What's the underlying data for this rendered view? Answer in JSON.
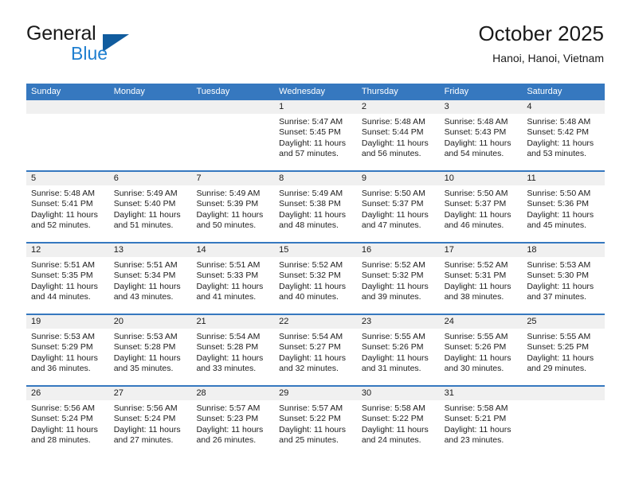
{
  "brand": {
    "name_part1": "General",
    "name_part2": "Blue",
    "accent_color": "#1f7fd0",
    "triangle_color": "#115c9e"
  },
  "header": {
    "title": "October 2025",
    "subtitle": "Hanoi, Hanoi, Vietnam",
    "header_bar_color": "#3678bf"
  },
  "weekdays": [
    "Sunday",
    "Monday",
    "Tuesday",
    "Wednesday",
    "Thursday",
    "Friday",
    "Saturday"
  ],
  "weeks": [
    [
      {
        "day": "",
        "empty": true
      },
      {
        "day": "",
        "empty": true
      },
      {
        "day": "",
        "empty": true
      },
      {
        "day": "1",
        "sunrise": "Sunrise: 5:47 AM",
        "sunset": "Sunset: 5:45 PM",
        "daylight": "Daylight: 11 hours and 57 minutes."
      },
      {
        "day": "2",
        "sunrise": "Sunrise: 5:48 AM",
        "sunset": "Sunset: 5:44 PM",
        "daylight": "Daylight: 11 hours and 56 minutes."
      },
      {
        "day": "3",
        "sunrise": "Sunrise: 5:48 AM",
        "sunset": "Sunset: 5:43 PM",
        "daylight": "Daylight: 11 hours and 54 minutes."
      },
      {
        "day": "4",
        "sunrise": "Sunrise: 5:48 AM",
        "sunset": "Sunset: 5:42 PM",
        "daylight": "Daylight: 11 hours and 53 minutes."
      }
    ],
    [
      {
        "day": "5",
        "sunrise": "Sunrise: 5:48 AM",
        "sunset": "Sunset: 5:41 PM",
        "daylight": "Daylight: 11 hours and 52 minutes."
      },
      {
        "day": "6",
        "sunrise": "Sunrise: 5:49 AM",
        "sunset": "Sunset: 5:40 PM",
        "daylight": "Daylight: 11 hours and 51 minutes."
      },
      {
        "day": "7",
        "sunrise": "Sunrise: 5:49 AM",
        "sunset": "Sunset: 5:39 PM",
        "daylight": "Daylight: 11 hours and 50 minutes."
      },
      {
        "day": "8",
        "sunrise": "Sunrise: 5:49 AM",
        "sunset": "Sunset: 5:38 PM",
        "daylight": "Daylight: 11 hours and 48 minutes."
      },
      {
        "day": "9",
        "sunrise": "Sunrise: 5:50 AM",
        "sunset": "Sunset: 5:37 PM",
        "daylight": "Daylight: 11 hours and 47 minutes."
      },
      {
        "day": "10",
        "sunrise": "Sunrise: 5:50 AM",
        "sunset": "Sunset: 5:37 PM",
        "daylight": "Daylight: 11 hours and 46 minutes."
      },
      {
        "day": "11",
        "sunrise": "Sunrise: 5:50 AM",
        "sunset": "Sunset: 5:36 PM",
        "daylight": "Daylight: 11 hours and 45 minutes."
      }
    ],
    [
      {
        "day": "12",
        "sunrise": "Sunrise: 5:51 AM",
        "sunset": "Sunset: 5:35 PM",
        "daylight": "Daylight: 11 hours and 44 minutes."
      },
      {
        "day": "13",
        "sunrise": "Sunrise: 5:51 AM",
        "sunset": "Sunset: 5:34 PM",
        "daylight": "Daylight: 11 hours and 43 minutes."
      },
      {
        "day": "14",
        "sunrise": "Sunrise: 5:51 AM",
        "sunset": "Sunset: 5:33 PM",
        "daylight": "Daylight: 11 hours and 41 minutes."
      },
      {
        "day": "15",
        "sunrise": "Sunrise: 5:52 AM",
        "sunset": "Sunset: 5:32 PM",
        "daylight": "Daylight: 11 hours and 40 minutes."
      },
      {
        "day": "16",
        "sunrise": "Sunrise: 5:52 AM",
        "sunset": "Sunset: 5:32 PM",
        "daylight": "Daylight: 11 hours and 39 minutes."
      },
      {
        "day": "17",
        "sunrise": "Sunrise: 5:52 AM",
        "sunset": "Sunset: 5:31 PM",
        "daylight": "Daylight: 11 hours and 38 minutes."
      },
      {
        "day": "18",
        "sunrise": "Sunrise: 5:53 AM",
        "sunset": "Sunset: 5:30 PM",
        "daylight": "Daylight: 11 hours and 37 minutes."
      }
    ],
    [
      {
        "day": "19",
        "sunrise": "Sunrise: 5:53 AM",
        "sunset": "Sunset: 5:29 PM",
        "daylight": "Daylight: 11 hours and 36 minutes."
      },
      {
        "day": "20",
        "sunrise": "Sunrise: 5:53 AM",
        "sunset": "Sunset: 5:28 PM",
        "daylight": "Daylight: 11 hours and 35 minutes."
      },
      {
        "day": "21",
        "sunrise": "Sunrise: 5:54 AM",
        "sunset": "Sunset: 5:28 PM",
        "daylight": "Daylight: 11 hours and 33 minutes."
      },
      {
        "day": "22",
        "sunrise": "Sunrise: 5:54 AM",
        "sunset": "Sunset: 5:27 PM",
        "daylight": "Daylight: 11 hours and 32 minutes."
      },
      {
        "day": "23",
        "sunrise": "Sunrise: 5:55 AM",
        "sunset": "Sunset: 5:26 PM",
        "daylight": "Daylight: 11 hours and 31 minutes."
      },
      {
        "day": "24",
        "sunrise": "Sunrise: 5:55 AM",
        "sunset": "Sunset: 5:26 PM",
        "daylight": "Daylight: 11 hours and 30 minutes."
      },
      {
        "day": "25",
        "sunrise": "Sunrise: 5:55 AM",
        "sunset": "Sunset: 5:25 PM",
        "daylight": "Daylight: 11 hours and 29 minutes."
      }
    ],
    [
      {
        "day": "26",
        "sunrise": "Sunrise: 5:56 AM",
        "sunset": "Sunset: 5:24 PM",
        "daylight": "Daylight: 11 hours and 28 minutes."
      },
      {
        "day": "27",
        "sunrise": "Sunrise: 5:56 AM",
        "sunset": "Sunset: 5:24 PM",
        "daylight": "Daylight: 11 hours and 27 minutes."
      },
      {
        "day": "28",
        "sunrise": "Sunrise: 5:57 AM",
        "sunset": "Sunset: 5:23 PM",
        "daylight": "Daylight: 11 hours and 26 minutes."
      },
      {
        "day": "29",
        "sunrise": "Sunrise: 5:57 AM",
        "sunset": "Sunset: 5:22 PM",
        "daylight": "Daylight: 11 hours and 25 minutes."
      },
      {
        "day": "30",
        "sunrise": "Sunrise: 5:58 AM",
        "sunset": "Sunset: 5:22 PM",
        "daylight": "Daylight: 11 hours and 24 minutes."
      },
      {
        "day": "31",
        "sunrise": "Sunrise: 5:58 AM",
        "sunset": "Sunset: 5:21 PM",
        "daylight": "Daylight: 11 hours and 23 minutes."
      },
      {
        "day": "",
        "empty": true
      }
    ]
  ]
}
